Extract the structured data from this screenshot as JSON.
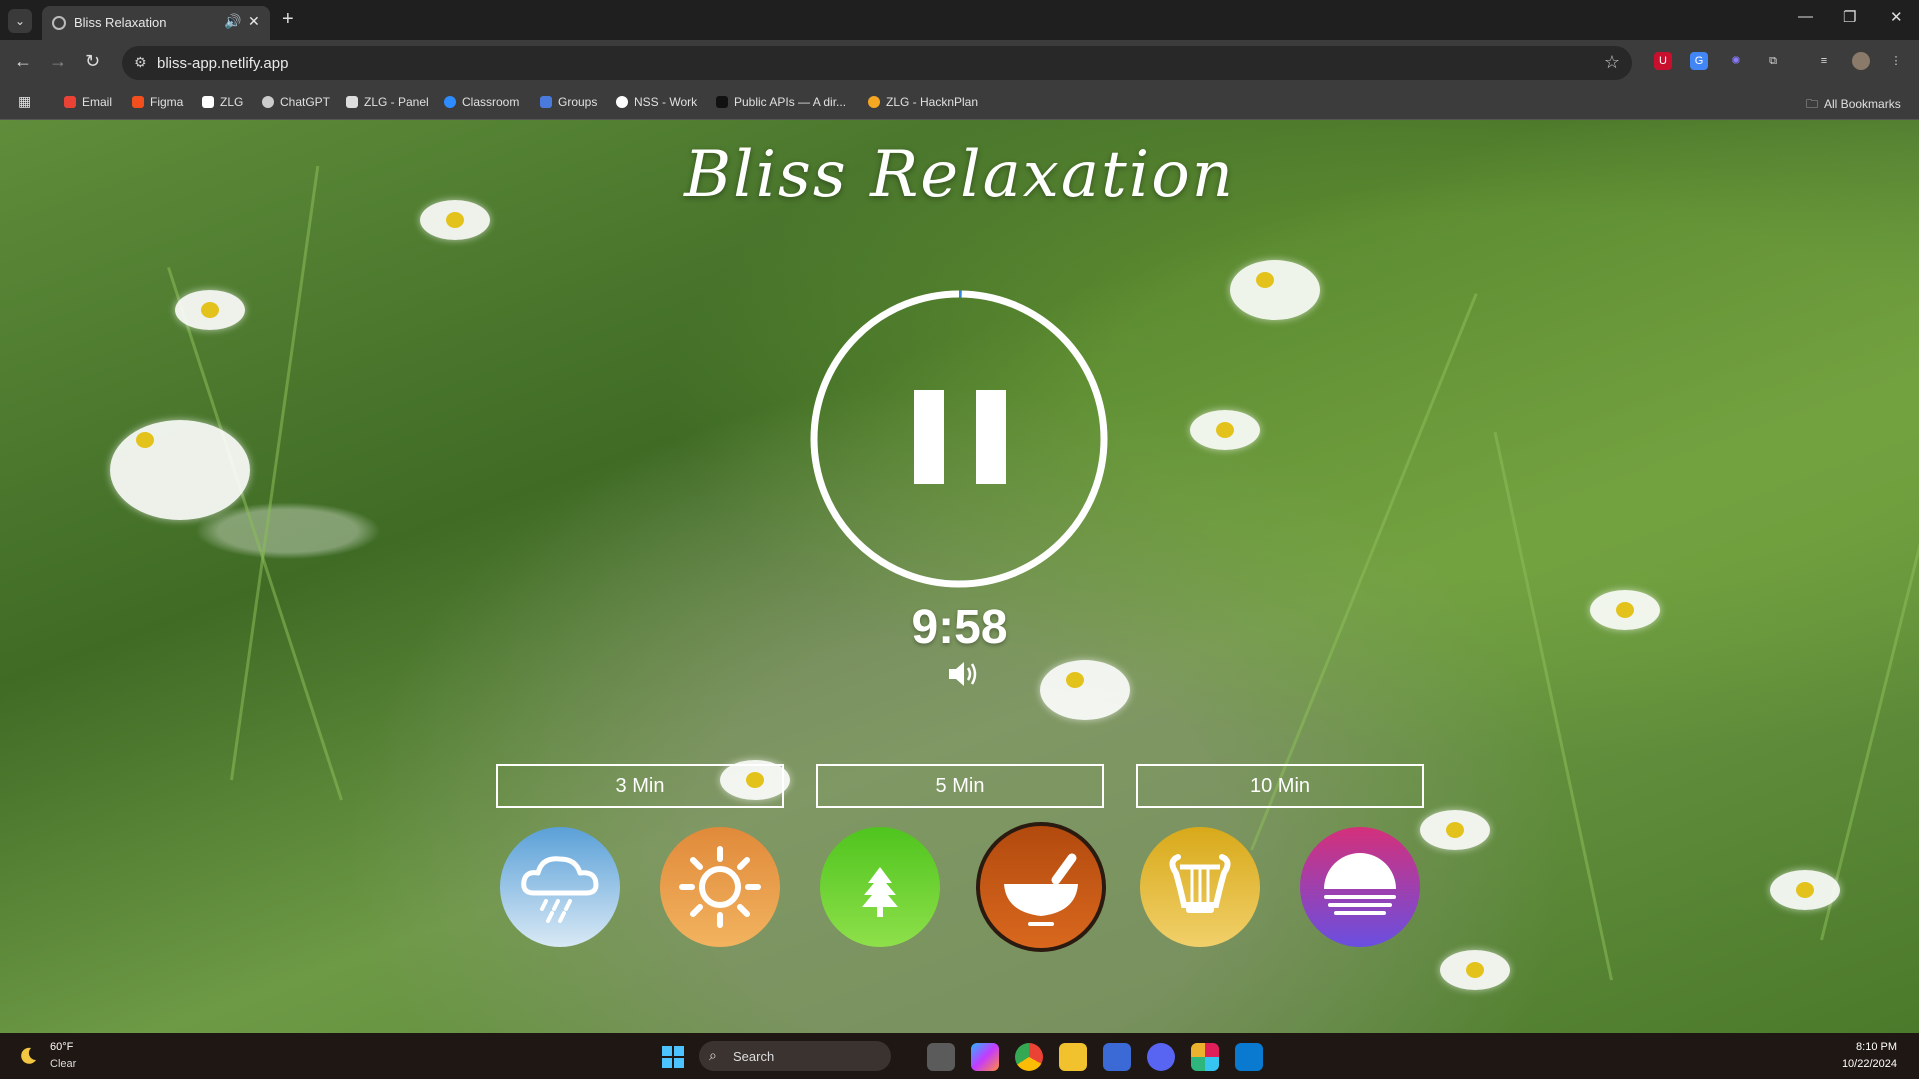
{
  "browser": {
    "tab_title": "Bliss Relaxation",
    "tab_audio_icon": "speaker-icon",
    "new_tab_label": "+",
    "url": "bliss-app.netlify.app",
    "window_controls": [
      "—",
      "❐",
      "✕"
    ],
    "bookmarks": [
      {
        "label": "Email",
        "color": "#EA4335"
      },
      {
        "label": "Figma",
        "color": "#F24E1E"
      },
      {
        "label": "ZLG",
        "color": "#ffffff"
      },
      {
        "label": "ChatGPT",
        "color": "#cccccc"
      },
      {
        "label": "ZLG - Panel",
        "color": "#dddddd"
      },
      {
        "label": "Classroom",
        "color": "#2D8CFF"
      },
      {
        "label": "Groups",
        "color": "#4a7bdc"
      },
      {
        "label": "NSS - Work",
        "color": "#ffffff"
      },
      {
        "label": "Public APIs — A dir...",
        "color": "#111111"
      },
      {
        "label": "ZLG - HacknPlan",
        "color": "#F5A623"
      }
    ],
    "all_bookmarks": "All Bookmarks"
  },
  "app": {
    "title": "Bliss Relaxation",
    "timer_display": "9:58",
    "progress_fraction": 0.003,
    "time_options": [
      "3 Min",
      "5 Min",
      "10 Min"
    ],
    "sounds": [
      {
        "name": "rain",
        "icon": "rain-cloud-icon",
        "color_top": "#5aa0d8",
        "color_bottom": "#d9e9f5"
      },
      {
        "name": "sunny",
        "icon": "sun-icon",
        "color_top": "#e08a3a",
        "color_bottom": "#f2b35f"
      },
      {
        "name": "forest",
        "icon": "tree-icon",
        "color_top": "#4fc41e",
        "color_bottom": "#8ee04a"
      },
      {
        "name": "singing-bowl",
        "icon": "bowl-icon",
        "color_top": "#b24a0e",
        "color_bottom": "#d9681e",
        "selected": true
      },
      {
        "name": "harp",
        "icon": "lyre-icon",
        "color_top": "#d8a91a",
        "color_bottom": "#f1d06a"
      },
      {
        "name": "sunset",
        "icon": "sunset-icon",
        "color_top": "#d4307a",
        "color_bottom": "#6a4fe0"
      }
    ]
  },
  "taskbar": {
    "weather_temp": "60°F",
    "weather_condition": "Clear",
    "search_placeholder": "Search",
    "time": "8:10 PM",
    "date": "10/22/2024"
  }
}
